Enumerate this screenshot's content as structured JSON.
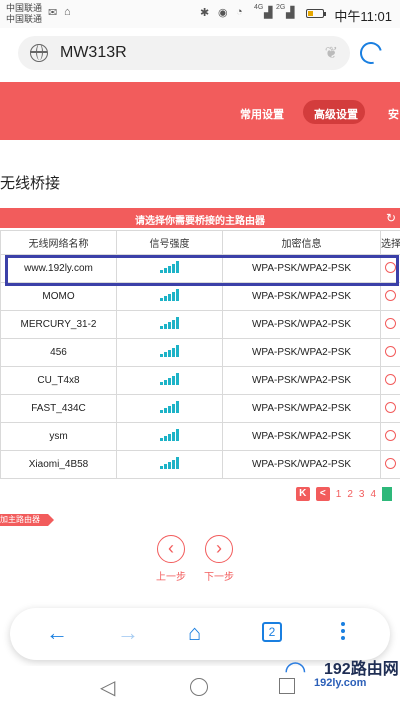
{
  "status_bar": {
    "carrier1": "中国联通",
    "carrier2": "中国联通",
    "time": "中午11:01",
    "signal_labels": [
      "4G",
      "2G"
    ]
  },
  "browser": {
    "address": "MW313R",
    "tab_count": "2"
  },
  "router_nav": {
    "items": [
      "常用设置",
      "高级设置",
      "安"
    ],
    "active_index": 1
  },
  "page": {
    "title": "无线桥接",
    "table_banner": "请选择你需要桥接的主路由器",
    "columns": [
      "无线网络名称",
      "信号强度",
      "加密信息",
      "选择"
    ],
    "rows": [
      {
        "ssid": "www.192ly.com",
        "security": "WPA-PSK/WPA2-PSK"
      },
      {
        "ssid": "MOMO",
        "security": "WPA-PSK/WPA2-PSK"
      },
      {
        "ssid": "MERCURY_31-2",
        "security": "WPA-PSK/WPA2-PSK"
      },
      {
        "ssid": "456",
        "security": "WPA-PSK/WPA2-PSK"
      },
      {
        "ssid": "CU_T4x8",
        "security": "WPA-PSK/WPA2-PSK"
      },
      {
        "ssid": "FAST_434C",
        "security": "WPA-PSK/WPA2-PSK"
      },
      {
        "ssid": "ysm",
        "security": "WPA-PSK/WPA2-PSK"
      },
      {
        "ssid": "Xiaomi_4B58",
        "security": "WPA-PSK/WPA2-PSK"
      }
    ],
    "pager": {
      "first": "K",
      "prev": "<",
      "pages": [
        "1",
        "2",
        "3",
        "4"
      ]
    },
    "add_router": "加主路由器",
    "prev_step": "上一步",
    "next_step": "下一步"
  },
  "watermark": {
    "brand": "192路由网",
    "url": "192ly.com"
  },
  "colors": {
    "accent": "#f25c5c",
    "browser_blue": "#1a7fe0",
    "signal": "#1db3c7",
    "highlight_border": "#3b40a8"
  }
}
